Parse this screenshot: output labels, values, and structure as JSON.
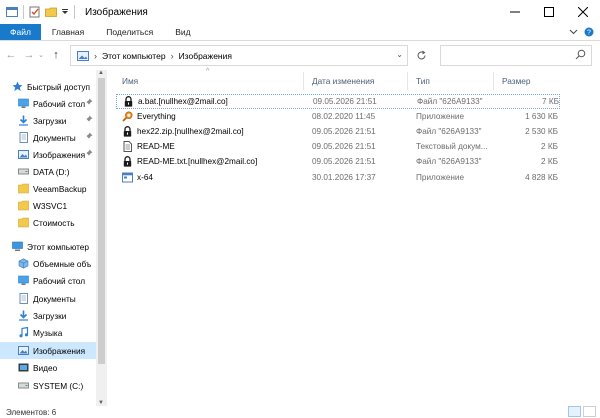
{
  "window": {
    "title": "Изображения",
    "controls": [
      "minimize-icon",
      "maximize-icon",
      "close-icon"
    ]
  },
  "ribbon": {
    "tabs": [
      "Файл",
      "Главная",
      "Поделиться",
      "Вид"
    ]
  },
  "address": {
    "crumbs": [
      "Этот компьютер",
      "Изображения"
    ],
    "search_placeholder": ""
  },
  "nav": {
    "items": [
      {
        "label": "Быстрый доступ",
        "icon": "star-icon",
        "pinned": false
      },
      {
        "label": "Рабочий стол",
        "icon": "desktop-icon",
        "pinned": true
      },
      {
        "label": "Загрузки",
        "icon": "download-icon",
        "pinned": true
      },
      {
        "label": "Документы",
        "icon": "documents-icon",
        "pinned": true
      },
      {
        "label": "Изображения",
        "icon": "pictures-icon",
        "pinned": true
      },
      {
        "label": "DATA (D:)",
        "icon": "drive-icon",
        "pinned": false
      },
      {
        "label": "VeeamBackup",
        "icon": "folder-icon",
        "pinned": false
      },
      {
        "label": "W3SVC1",
        "icon": "folder-icon",
        "pinned": false
      },
      {
        "label": "Стоимость",
        "icon": "folder-icon",
        "pinned": false
      },
      {
        "label": "Этот компьютер",
        "icon": "computer-icon",
        "pinned": false
      },
      {
        "label": "Объемные объ",
        "icon": "3d-objects-icon",
        "pinned": false
      },
      {
        "label": "Рабочий стол",
        "icon": "desktop-icon",
        "pinned": false
      },
      {
        "label": "Документы",
        "icon": "documents-icon",
        "pinned": false
      },
      {
        "label": "Загрузки",
        "icon": "download-icon",
        "pinned": false
      },
      {
        "label": "Музыка",
        "icon": "music-icon",
        "pinned": false
      },
      {
        "label": "Изображения",
        "icon": "pictures-icon",
        "pinned": false,
        "selected": true
      },
      {
        "label": "Видео",
        "icon": "video-icon",
        "pinned": false
      },
      {
        "label": "SYSTEM (C:)",
        "icon": "drive-icon",
        "pinned": false
      }
    ]
  },
  "columns": [
    "Имя",
    "Дата изменения",
    "Тип",
    "Размер"
  ],
  "files": [
    {
      "name": "a.bat.[nullhex@2mail.co]",
      "date": "09.05.2026 21:51",
      "type": "Файл \"626A9133\"",
      "size": "7 КБ",
      "icon": "lock-icon",
      "focused": true
    },
    {
      "name": "Everything",
      "date": "08.02.2020 11:45",
      "type": "Приложение",
      "size": "1 630 КБ",
      "icon": "everything-app-icon"
    },
    {
      "name": "hex22.zip.[nullhex@2mail.co]",
      "date": "09.05.2026 21:51",
      "type": "Файл \"626A9133\"",
      "size": "2 530 КБ",
      "icon": "lock-icon"
    },
    {
      "name": "READ-ME",
      "date": "09.05.2026 21:51",
      "type": "Текстовый докум...",
      "size": "2 КБ",
      "icon": "text-file-icon"
    },
    {
      "name": "READ-ME.txt.[nullhex@2mail.co]",
      "date": "09.05.2026 21:51",
      "type": "Файл \"626A9133\"",
      "size": "2 КБ",
      "icon": "lock-icon"
    },
    {
      "name": "x-64",
      "date": "30.01.2026 17:37",
      "type": "Приложение",
      "size": "4 828 КБ",
      "icon": "app-window-icon"
    }
  ],
  "status": {
    "text": "Элементов: 6"
  },
  "colors": {
    "accent": "#1979ca",
    "selection": "#cce8ff",
    "folder": "#f2c94c",
    "lock": "#1a1a1a"
  }
}
